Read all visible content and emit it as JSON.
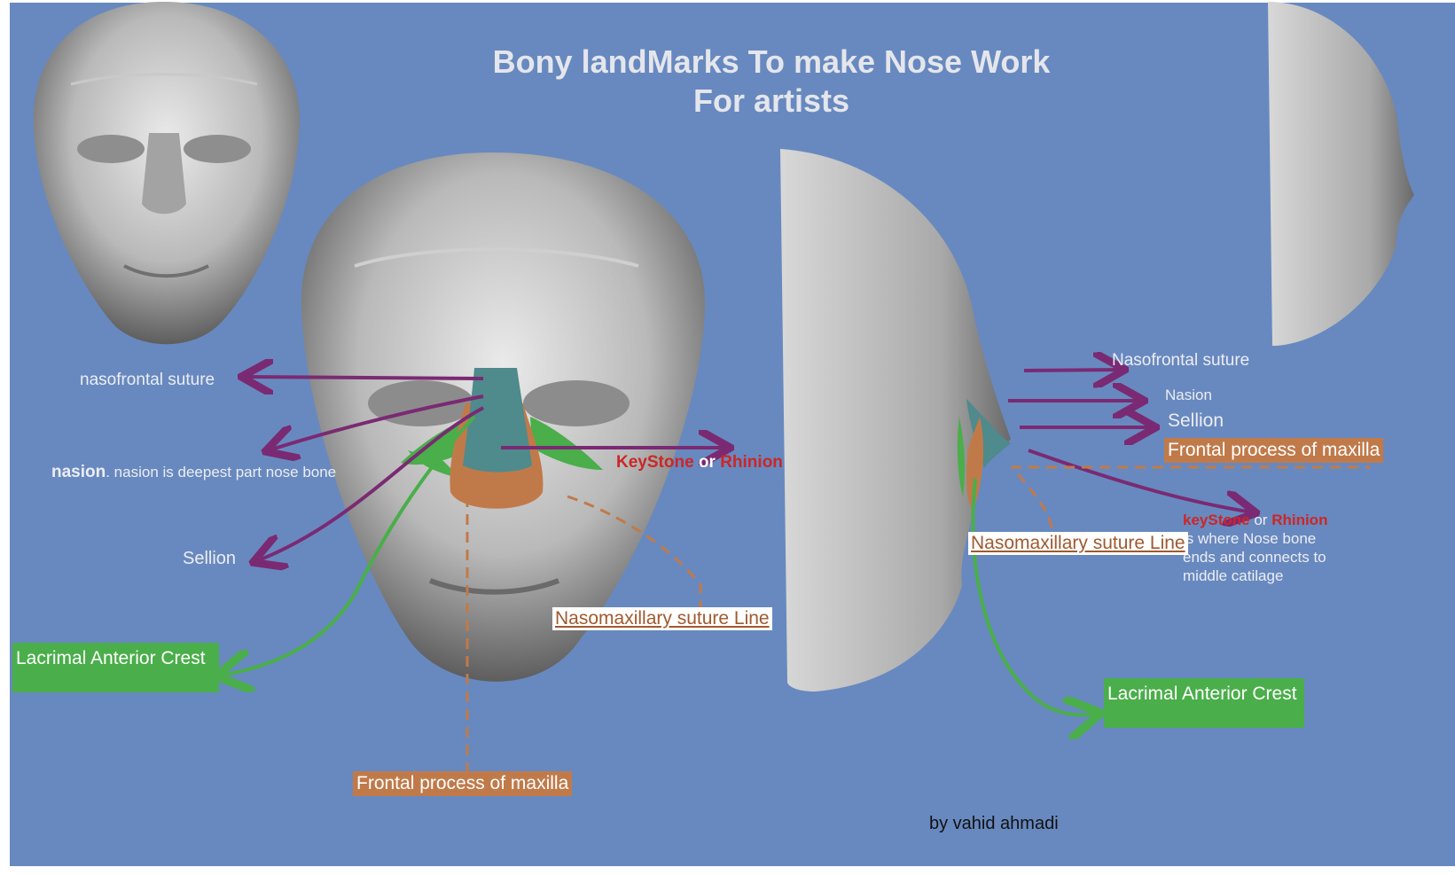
{
  "title": {
    "line1": "Bony landMarks To make Nose Work",
    "line2": "For artists"
  },
  "front": {
    "nasofrontal_suture": "nasofrontal suture",
    "nasion_bold": "nasion",
    "nasion_desc": ". nasion is deepest part nose bone",
    "sellion": "Sellion",
    "lacrimal": "Lacrimal Anterior Crest",
    "frontal_process": "Frontal process of maxilla",
    "nasomaxillary": "Nasomaxillary suture Line",
    "keystone": "KeyStone",
    "or": "or",
    "rhinion": "Rhinion"
  },
  "side": {
    "nasofrontal_suture": "Nasofrontal suture",
    "nasion": "Nasion",
    "sellion": "Sellion",
    "frontal_process": "Frontal process of maxilla",
    "keystone": "keyStone",
    "or": "or",
    "rhinion": "Rhinion",
    "desc1": "is where Nose bone",
    "desc2": "ends and connects to",
    "desc3": "middle catilage",
    "nasomaxillary": "Nasomaxillary suture Line",
    "lacrimal": "Lacrimal Anterior Crest"
  },
  "credit": "by vahid ahmadi",
  "colors": {
    "background": "#6889bf",
    "arrow_purple": "#7a2a73",
    "arrow_green": "#4aae4a",
    "bone_orange": "#c07a4a",
    "cartilage_teal": "#4f8a8c",
    "accent_red": "#cc2626"
  }
}
